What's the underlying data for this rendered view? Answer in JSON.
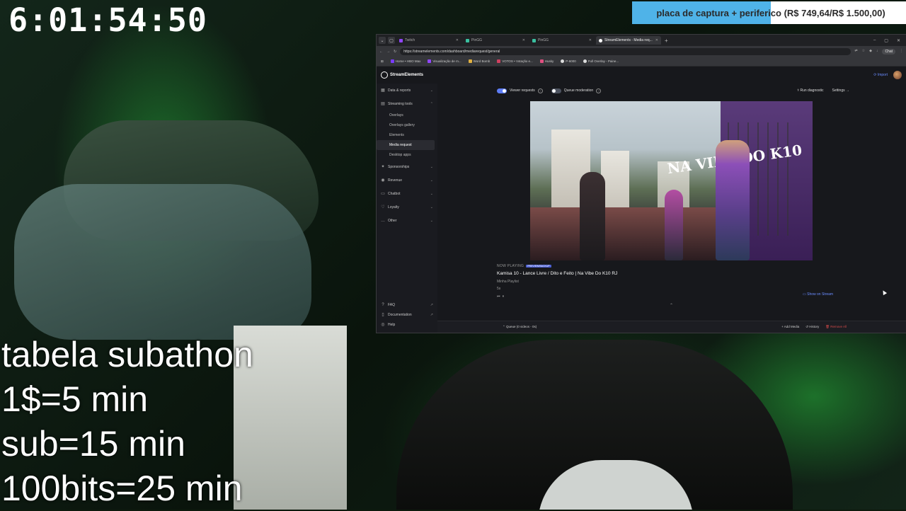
{
  "overlay": {
    "timer": "6:01:54:50",
    "goal": {
      "label": "placa de captura + periferico (R$ 749,64/R$ 1.500,00)",
      "progress": 0.4998
    },
    "sub_table": {
      "title": "tabela subathon",
      "lines": [
        "1$=5 min",
        "sub=15 min",
        "100bits=25 min"
      ]
    }
  },
  "browser": {
    "tabs": [
      {
        "label": "Twitch",
        "active": false,
        "color": "#9146ff"
      },
      {
        "label": "PinGG",
        "active": false,
        "color": "#3ac0a0"
      },
      {
        "label": "PinGG",
        "active": false,
        "color": "#3ac0a0"
      },
      {
        "label": "StreamElements - Media req...",
        "active": true,
        "color": "#ffffff"
      }
    ],
    "url": "https://streamelements.com/dashboard/mediarequest/general",
    "chat_label": "Chat",
    "bookmarks": [
      "Home • HBO Max",
      "Visualização de m...",
      "Word Bomb",
      "VOTOS • Votação e...",
      "Husky",
      "P-6000",
      "Full Overlay - Paine..."
    ]
  },
  "se": {
    "brand": "StreamElements",
    "import_label": "Import",
    "sidebar": {
      "items": [
        {
          "label": "Data & reports",
          "chev": "⌄"
        },
        {
          "label": "Streaming tools",
          "chev": "⌃"
        }
      ],
      "sub_items": [
        "Overlays",
        "Overlays gallery",
        "Elements",
        "Media request",
        "Desktop apps"
      ],
      "active_sub": "Media request",
      "more_items": [
        {
          "label": "Sponsorships",
          "chev": "⌄"
        },
        {
          "label": "Revenue",
          "chev": "⌄"
        },
        {
          "label": "Chatbot",
          "chev": "⌄"
        },
        {
          "label": "Loyalty",
          "chev": "⌄"
        },
        {
          "label": "Other",
          "chev": "⌄"
        }
      ],
      "bottom": [
        "FAQ",
        "Documentation",
        "Help"
      ]
    },
    "controls": {
      "viewer_requests": "Viewer requests",
      "queue_moderation": "Queue moderation",
      "run_diagnostic": "Run diagnostic",
      "settings": "Settings"
    },
    "now_playing": {
      "tag": "NOW PLAYING",
      "badge": "PREVIEW/BACKUP",
      "title": "Kamisa 10 - Lance Livre / Dito e Feito | Na Vibe Do K10 RJ",
      "playlist": "Minha Playlist",
      "duration": "5s"
    },
    "show_on_stream": "Show on Stream",
    "queue": {
      "label": "Queue (0 videos - 0s)",
      "add_media": "Add Media",
      "history": "History",
      "remove_all": "Remove All"
    },
    "stage_text": "NA VIBE DO K10"
  }
}
